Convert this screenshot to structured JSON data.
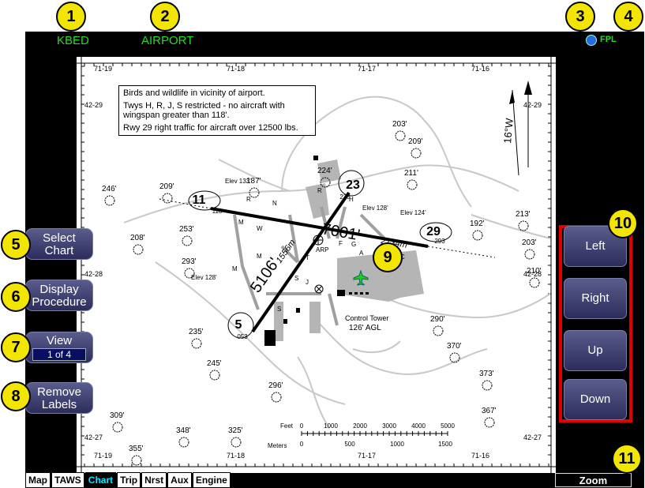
{
  "header": {
    "airport_id": "KBED",
    "page_title": "AIRPORT",
    "fpl_label": "FPL"
  },
  "callouts": [
    "1",
    "2",
    "3",
    "4",
    "5",
    "6",
    "7",
    "8",
    "9",
    "10",
    "11"
  ],
  "left_buttons": {
    "select_chart": [
      "Select",
      "Chart"
    ],
    "display_procedure": [
      "Display",
      "Procedure"
    ],
    "view": {
      "label": "View",
      "value": "1 of 4"
    },
    "remove_labels": [
      "Remove",
      "Labels"
    ]
  },
  "right_buttons": {
    "left": "Left",
    "right": "Right",
    "up": "Up",
    "down": "Down"
  },
  "notes": [
    "Birds and wildlife in vicinity of airport.",
    "Twys H, R, J, S restricted - no aircraft with wingspan greater than 118'.",
    "Rwy 29 right traffic for aircraft over 12500 lbs."
  ],
  "chart": {
    "top_longitudes": [
      "71-19",
      "71-18",
      "71-17",
      "71-16"
    ],
    "bottom_longitudes": [
      "71-19",
      "71-18",
      "71-17",
      "71-16"
    ],
    "latitudes": [
      "42-29",
      "42-28",
      "42-27"
    ],
    "runway_long": {
      "length": "7001'",
      "meters": "2134m",
      "end_a": "11",
      "end_b": "29",
      "end_a_mag": "113",
      "end_b_mag": "293"
    },
    "runway_short": {
      "length": "5106'",
      "meters": "1556m",
      "end_a": "5",
      "end_b": "23",
      "end_a_mag": "053",
      "end_b_mag": "233"
    },
    "elevations": [
      "Elev 133'",
      "Elev 128'",
      "Elev 124'",
      "Elev 128'"
    ],
    "taxiways": [
      "R",
      "N",
      "R",
      "H",
      "W",
      "M",
      "T",
      "ARP",
      "F",
      "G",
      "A",
      "C",
      "M",
      "S",
      "J",
      "S",
      "M"
    ],
    "tower": {
      "name": "Control Tower",
      "height": "126' AGL"
    },
    "obstacles": [
      "246'",
      "209'",
      "187'",
      "224'",
      "203'",
      "209'",
      "211'",
      "208'",
      "253'",
      "293'",
      "192'",
      "213'",
      "203'",
      "210'",
      "290'",
      "235'",
      "245'",
      "296'",
      "370'",
      "373'",
      "367'",
      "309'",
      "348'",
      "325'",
      "355'"
    ],
    "magvar": "16°W",
    "scale": {
      "feet_label": "Feet",
      "meters_label": "Meters",
      "feet_ticks": [
        "0",
        "1000",
        "2000",
        "3000",
        "4000",
        "5000"
      ],
      "meter_ticks": [
        "0",
        "500",
        "1000",
        "1500"
      ]
    }
  },
  "tabs": [
    "Map",
    "TAWS",
    "Chart",
    "Trip",
    "Nrst",
    "Aux",
    "Engine"
  ],
  "active_tab": "Chart",
  "zoom_label": "Zoom"
}
